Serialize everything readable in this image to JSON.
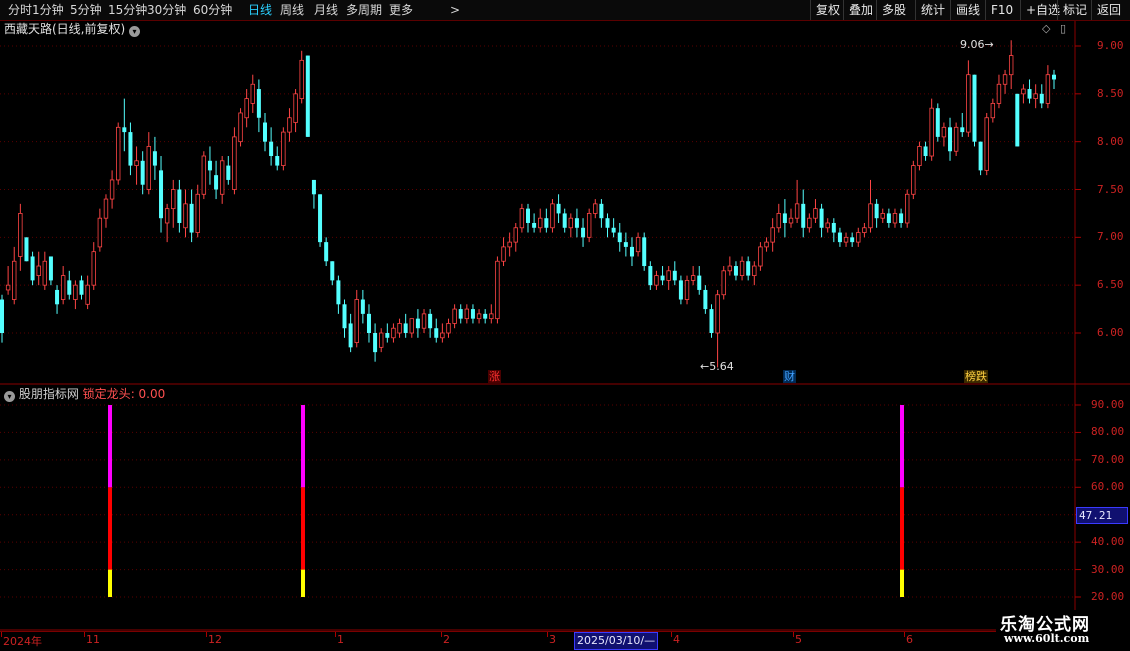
{
  "toolbar": {
    "periods": [
      "分时",
      "1分钟",
      "5分钟",
      "15分钟",
      "30分钟",
      "60分钟",
      "日线",
      "周线",
      "月线",
      "多周期",
      "更多"
    ],
    "active": "日线",
    "more_arrow": ">",
    "right_buttons": [
      "复权",
      "叠加",
      "多股",
      "统计",
      "画线",
      "F10",
      "+自选",
      "标记",
      "返回"
    ]
  },
  "chart": {
    "title": "西藏天路(日线,前复权)",
    "high_label": "9.06",
    "low_label": "5.64",
    "y_ticks": [
      "9.00",
      "8.50",
      "8.00",
      "7.50",
      "7.00",
      "6.50",
      "6.00"
    ],
    "markers": [
      {
        "text": "涨",
        "color": "#ff3030",
        "bg": "#4a0000"
      },
      {
        "text": "财",
        "color": "#40a0ff",
        "bg": "#002a55"
      },
      {
        "text": "榜跌",
        "color": "#ffd040",
        "bg": "#3a2a00"
      }
    ],
    "colors": {
      "up": "#ff4545",
      "down": "#54ffff",
      "grid": "#5a0000"
    }
  },
  "indicator": {
    "source": "股朋指标网",
    "name": "锁定龙头",
    "value": "0.00",
    "y_ticks": [
      "90.00",
      "80.00",
      "70.00",
      "60.00",
      "50.00",
      "40.00",
      "30.00",
      "20.00"
    ],
    "current_value": "47.21",
    "signal_colors": {
      "top": "#ff00ff",
      "mid": "#ff0000",
      "bottom": "#ffff00"
    },
    "signal_levels": [
      20,
      30,
      60,
      90
    ]
  },
  "date_axis": {
    "labels": [
      "2024年",
      "11",
      "12",
      "1",
      "2",
      "3",
      "4",
      "5",
      "6"
    ],
    "cursor_date": "2025/03/10/—"
  },
  "logo": {
    "line1": "乐淘公式网",
    "line2": "www.60lt.com"
  },
  "chart_data": {
    "type": "candlestick",
    "y_range": [
      5.5,
      9.25
    ],
    "ohlc": [
      [
        6.35,
        6.4,
        6.0,
        5.9
      ],
      [
        6.45,
        6.7,
        6.5,
        6.4
      ],
      [
        6.35,
        6.9,
        6.75,
        6.3
      ],
      [
        6.8,
        7.35,
        7.25,
        6.65
      ],
      [
        7.0,
        7.0,
        6.75,
        6.75
      ],
      [
        6.8,
        6.85,
        6.55,
        6.5
      ],
      [
        6.6,
        6.85,
        6.7,
        6.5
      ],
      [
        6.5,
        6.85,
        6.75,
        6.45
      ],
      [
        6.8,
        6.8,
        6.55,
        6.5
      ],
      [
        6.45,
        6.5,
        6.3,
        6.2
      ],
      [
        6.35,
        6.7,
        6.6,
        6.3
      ],
      [
        6.55,
        6.65,
        6.4,
        6.35
      ],
      [
        6.35,
        6.55,
        6.5,
        6.25
      ],
      [
        6.55,
        6.6,
        6.4,
        6.35
      ],
      [
        6.3,
        6.6,
        6.5,
        6.25
      ],
      [
        6.5,
        6.95,
        6.85,
        6.45
      ],
      [
        6.9,
        7.3,
        7.2,
        6.85
      ],
      [
        7.2,
        7.45,
        7.4,
        7.1
      ],
      [
        7.4,
        7.7,
        7.6,
        7.3
      ],
      [
        7.6,
        8.2,
        8.15,
        7.55
      ],
      [
        8.15,
        8.45,
        8.1,
        7.9
      ],
      [
        8.1,
        8.2,
        7.75,
        7.65
      ],
      [
        7.75,
        7.95,
        7.8,
        7.55
      ],
      [
        7.8,
        7.9,
        7.55,
        7.45
      ],
      [
        7.5,
        8.1,
        7.95,
        7.45
      ],
      [
        7.9,
        8.05,
        7.75,
        7.6
      ],
      [
        7.7,
        7.85,
        7.2,
        7.05
      ],
      [
        7.15,
        7.35,
        7.3,
        6.95
      ],
      [
        7.3,
        7.6,
        7.5,
        7.1
      ],
      [
        7.5,
        7.6,
        7.15,
        7.05
      ],
      [
        7.1,
        7.5,
        7.35,
        7.0
      ],
      [
        7.35,
        7.5,
        7.05,
        6.95
      ],
      [
        7.05,
        7.55,
        7.45,
        7.0
      ],
      [
        7.45,
        7.9,
        7.85,
        7.4
      ],
      [
        7.8,
        7.95,
        7.7,
        7.55
      ],
      [
        7.65,
        7.8,
        7.5,
        7.4
      ],
      [
        7.45,
        7.85,
        7.8,
        7.35
      ],
      [
        7.75,
        7.85,
        7.6,
        7.55
      ],
      [
        7.5,
        8.15,
        8.05,
        7.45
      ],
      [
        8.0,
        8.35,
        8.3,
        7.95
      ],
      [
        8.25,
        8.55,
        8.45,
        8.15
      ],
      [
        8.4,
        8.7,
        8.6,
        8.3
      ],
      [
        8.55,
        8.65,
        8.25,
        8.1
      ],
      [
        8.2,
        8.3,
        8.0,
        7.9
      ],
      [
        8.0,
        8.15,
        7.85,
        7.75
      ],
      [
        7.85,
        7.95,
        7.75,
        7.7
      ],
      [
        7.75,
        8.15,
        8.1,
        7.7
      ],
      [
        8.1,
        8.35,
        8.25,
        8.0
      ],
      [
        8.2,
        8.55,
        8.5,
        8.1
      ],
      [
        8.45,
        8.95,
        8.85,
        8.4
      ],
      [
        8.9,
        8.9,
        8.05,
        8.05
      ],
      [
        7.6,
        7.6,
        7.45,
        7.3
      ],
      [
        7.45,
        7.45,
        6.95,
        6.9
      ],
      [
        6.95,
        7.0,
        6.75,
        6.7
      ],
      [
        6.75,
        6.75,
        6.55,
        6.5
      ],
      [
        6.55,
        6.6,
        6.3,
        6.2
      ],
      [
        6.3,
        6.35,
        6.05,
        5.95
      ],
      [
        6.1,
        6.2,
        5.85,
        5.8
      ],
      [
        5.9,
        6.45,
        6.35,
        5.85
      ],
      [
        6.35,
        6.45,
        6.2,
        6.1
      ],
      [
        6.2,
        6.3,
        6.0,
        5.9
      ],
      [
        6.0,
        6.1,
        5.8,
        5.7
      ],
      [
        5.85,
        6.05,
        6.0,
        5.8
      ],
      [
        6.0,
        6.1,
        5.95,
        5.9
      ],
      [
        5.95,
        6.1,
        6.05,
        5.9
      ],
      [
        6.0,
        6.15,
        6.1,
        5.95
      ],
      [
        6.1,
        6.2,
        6.0,
        5.95
      ],
      [
        6.0,
        6.15,
        6.15,
        5.95
      ],
      [
        6.15,
        6.25,
        6.05,
        5.95
      ],
      [
        6.05,
        6.25,
        6.2,
        6.0
      ],
      [
        6.2,
        6.25,
        6.05,
        5.95
      ],
      [
        6.05,
        6.15,
        5.95,
        5.9
      ],
      [
        5.95,
        6.1,
        6.0,
        5.9
      ],
      [
        6.0,
        6.15,
        6.1,
        5.95
      ],
      [
        6.1,
        6.3,
        6.25,
        6.05
      ],
      [
        6.25,
        6.3,
        6.15,
        6.1
      ],
      [
        6.15,
        6.3,
        6.25,
        6.1
      ],
      [
        6.25,
        6.3,
        6.15,
        6.1
      ],
      [
        6.15,
        6.25,
        6.2,
        6.1
      ],
      [
        6.2,
        6.25,
        6.15,
        6.1
      ],
      [
        6.15,
        6.3,
        6.2,
        6.1
      ],
      [
        6.15,
        6.8,
        6.75,
        6.1
      ],
      [
        6.75,
        7.0,
        6.9,
        6.7
      ],
      [
        6.9,
        7.05,
        6.95,
        6.8
      ],
      [
        6.95,
        7.15,
        7.1,
        6.85
      ],
      [
        7.1,
        7.35,
        7.3,
        7.05
      ],
      [
        7.3,
        7.35,
        7.15,
        7.05
      ],
      [
        7.15,
        7.25,
        7.1,
        7.05
      ],
      [
        7.1,
        7.3,
        7.2,
        7.05
      ],
      [
        7.2,
        7.3,
        7.1,
        7.05
      ],
      [
        7.1,
        7.4,
        7.35,
        7.05
      ],
      [
        7.35,
        7.45,
        7.25,
        7.15
      ],
      [
        7.25,
        7.3,
        7.1,
        7.05
      ],
      [
        7.1,
        7.25,
        7.2,
        7.0
      ],
      [
        7.2,
        7.3,
        7.1,
        7.0
      ],
      [
        7.1,
        7.2,
        7.0,
        6.9
      ],
      [
        7.0,
        7.3,
        7.25,
        6.95
      ],
      [
        7.25,
        7.4,
        7.35,
        7.2
      ],
      [
        7.35,
        7.4,
        7.2,
        7.1
      ],
      [
        7.2,
        7.25,
        7.1,
        7.0
      ],
      [
        7.1,
        7.2,
        7.05,
        7.0
      ],
      [
        7.05,
        7.15,
        6.95,
        6.85
      ],
      [
        6.95,
        7.05,
        6.9,
        6.8
      ],
      [
        6.9,
        7.0,
        6.8,
        6.7
      ],
      [
        6.85,
        7.05,
        7.0,
        6.8
      ],
      [
        7.0,
        7.05,
        6.7,
        6.65
      ],
      [
        6.7,
        6.75,
        6.5,
        6.45
      ],
      [
        6.5,
        6.65,
        6.6,
        6.45
      ],
      [
        6.6,
        6.7,
        6.55,
        6.5
      ],
      [
        6.55,
        6.7,
        6.65,
        6.45
      ],
      [
        6.65,
        6.75,
        6.55,
        6.5
      ],
      [
        6.55,
        6.6,
        6.35,
        6.3
      ],
      [
        6.35,
        6.6,
        6.55,
        6.3
      ],
      [
        6.55,
        6.7,
        6.6,
        6.5
      ],
      [
        6.6,
        6.7,
        6.45,
        6.4
      ],
      [
        6.45,
        6.5,
        6.25,
        6.2
      ],
      [
        6.25,
        6.3,
        6.0,
        5.95
      ],
      [
        6.0,
        6.45,
        6.4,
        5.64
      ],
      [
        6.4,
        6.7,
        6.65,
        6.35
      ],
      [
        6.65,
        6.8,
        6.7,
        6.6
      ],
      [
        6.7,
        6.75,
        6.6,
        6.55
      ],
      [
        6.6,
        6.8,
        6.75,
        6.55
      ],
      [
        6.75,
        6.8,
        6.6,
        6.55
      ],
      [
        6.6,
        6.75,
        6.7,
        6.5
      ],
      [
        6.7,
        6.95,
        6.9,
        6.65
      ],
      [
        6.9,
        7.0,
        6.95,
        6.85
      ],
      [
        6.95,
        7.2,
        7.1,
        6.85
      ],
      [
        7.1,
        7.35,
        7.25,
        7.05
      ],
      [
        7.25,
        7.4,
        7.15,
        7.0
      ],
      [
        7.15,
        7.3,
        7.2,
        7.1
      ],
      [
        7.2,
        7.6,
        7.35,
        7.15
      ],
      [
        7.35,
        7.5,
        7.1,
        7.0
      ],
      [
        7.1,
        7.25,
        7.2,
        7.05
      ],
      [
        7.2,
        7.4,
        7.3,
        7.15
      ],
      [
        7.3,
        7.35,
        7.1,
        7.0
      ],
      [
        7.1,
        7.2,
        7.15,
        7.05
      ],
      [
        7.15,
        7.2,
        7.05,
        6.95
      ],
      [
        7.05,
        7.1,
        6.95,
        6.9
      ],
      [
        6.95,
        7.05,
        7.0,
        6.9
      ],
      [
        7.0,
        7.05,
        6.95,
        6.9
      ],
      [
        6.95,
        7.1,
        7.05,
        6.9
      ],
      [
        7.05,
        7.15,
        7.1,
        7.0
      ],
      [
        7.1,
        7.6,
        7.35,
        7.05
      ],
      [
        7.35,
        7.4,
        7.2,
        7.1
      ],
      [
        7.2,
        7.3,
        7.25,
        7.15
      ],
      [
        7.25,
        7.3,
        7.15,
        7.1
      ],
      [
        7.15,
        7.3,
        7.25,
        7.1
      ],
      [
        7.25,
        7.3,
        7.15,
        7.1
      ],
      [
        7.15,
        7.5,
        7.45,
        7.1
      ],
      [
        7.45,
        7.8,
        7.75,
        7.4
      ],
      [
        7.75,
        8.0,
        7.95,
        7.7
      ],
      [
        7.95,
        8.0,
        7.85,
        7.8
      ],
      [
        7.85,
        8.45,
        8.35,
        7.8
      ],
      [
        8.35,
        8.4,
        8.05,
        8.0
      ],
      [
        8.05,
        8.2,
        8.15,
        7.95
      ],
      [
        8.15,
        8.25,
        7.9,
        7.8
      ],
      [
        7.9,
        8.2,
        8.15,
        7.85
      ],
      [
        8.15,
        8.3,
        8.1,
        8.05
      ],
      [
        8.1,
        8.85,
        8.7,
        8.05
      ],
      [
        8.7,
        8.7,
        8.0,
        7.95
      ],
      [
        8.0,
        8.0,
        7.7,
        7.65
      ],
      [
        7.7,
        8.3,
        8.25,
        7.65
      ],
      [
        8.25,
        8.45,
        8.4,
        8.2
      ],
      [
        8.4,
        8.7,
        8.6,
        8.35
      ],
      [
        8.6,
        8.75,
        8.7,
        8.5
      ],
      [
        8.7,
        9.06,
        8.9,
        8.55
      ],
      [
        8.5,
        8.5,
        7.95,
        7.95
      ],
      [
        8.5,
        8.6,
        8.55,
        8.4
      ],
      [
        8.55,
        8.65,
        8.45,
        8.4
      ],
      [
        8.45,
        8.6,
        8.5,
        8.35
      ],
      [
        8.5,
        8.6,
        8.4,
        8.35
      ],
      [
        8.4,
        8.8,
        8.7,
        8.35
      ],
      [
        8.7,
        8.75,
        8.65,
        8.55
      ]
    ],
    "high_point": 9.06,
    "low_point": 5.64,
    "indicator_signal_bars": 3
  }
}
